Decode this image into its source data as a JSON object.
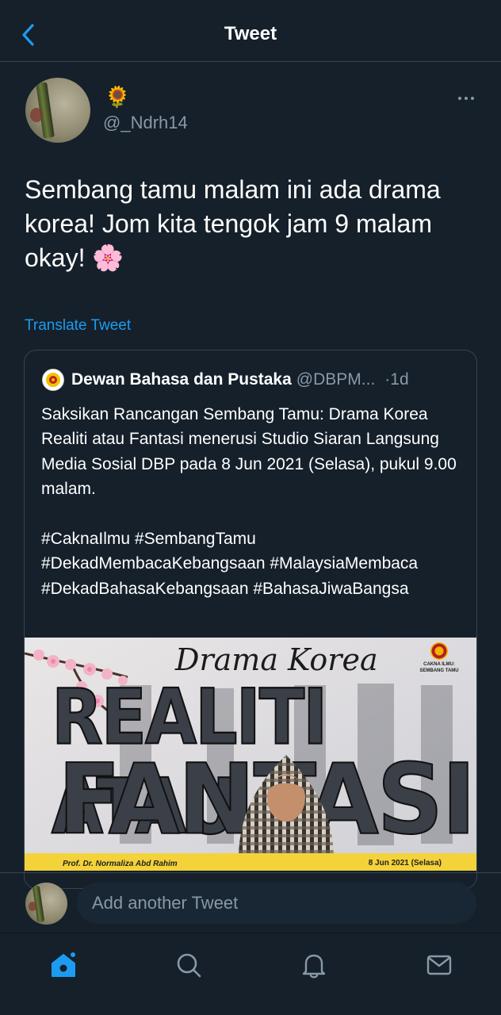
{
  "header": {
    "title": "Tweet",
    "back_icon": "chevron-left-icon"
  },
  "tweet": {
    "display_name": "🌻",
    "handle": "@_Ndrh14",
    "text": "Sembang tamu malam ini ada drama korea! Jom kita tengok jam 9 malam okay! 🌸",
    "translate_label": "Translate Tweet"
  },
  "quote": {
    "name": "Dewan Bahasa dan Pustaka",
    "handle": "@DBPM...",
    "time": "·1d",
    "body": "Saksikan Rancangan Sembang Tamu: Drama Korea Realiti atau Fantasi menerusi Studio Siaran Langsung Media Sosial DBP pada 8 Jun 2021 (Selasa), pukul 9.00 malam.",
    "hashtags": "#CaknaIlmu #SembangTamu #DekadMembacaKebangsaan #MalaysiaMembaca #DekadBahasaKebangsaan #BahasaJiwaBangsa",
    "poster": {
      "subtitle": "Drama Korea",
      "title_line1": "REALITI ATAU",
      "title_line2": "FANTASI",
      "org_line1": "CAKNA ILMU:",
      "org_line2": "SEMBANG TAMU",
      "speaker": "Prof. Dr. Normaliza Abd Rahim",
      "date": "8 Jun 2021 (Selasa)"
    }
  },
  "reply": {
    "placeholder": "Add another Tweet"
  },
  "nav": {
    "items": [
      "home-icon",
      "search-icon",
      "notifications-icon",
      "messages-icon"
    ]
  },
  "colors": {
    "background": "#15202b",
    "accent": "#1d9bf0",
    "secondary_text": "#8899a6",
    "border": "#38444d"
  }
}
